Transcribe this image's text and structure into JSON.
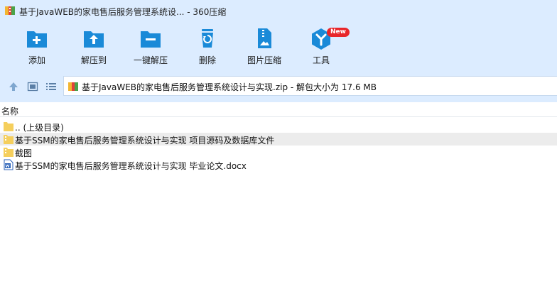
{
  "window": {
    "title": "基于JavaWEB的家电售后服务管理系统设...  - 360压缩"
  },
  "toolbar": {
    "add_label": "添加",
    "extract_label": "解压到",
    "one_click_label": "一键解压",
    "delete_label": "删除",
    "image_compress_label": "图片压缩",
    "tools_label": "工具",
    "tools_badge": "New"
  },
  "address": {
    "path": "基于JavaWEB的家电售后服务管理系统设计与实现.zip - 解包大小为 17.6 MB"
  },
  "list": {
    "column_name": "名称",
    "items": [
      {
        "name": ".. (上级目录)",
        "icon": "folder-up-icon"
      },
      {
        "name": "基于SSM的家电售后服务管理系统设计与实现 项目源码及数据库文件",
        "icon": "folder-zip-icon"
      },
      {
        "name": "截图",
        "icon": "folder-zip-icon"
      },
      {
        "name": "基于SSM的家电售后服务管理系统设计与实现 毕业论文.docx",
        "icon": "word-doc-icon"
      }
    ]
  },
  "colors": {
    "chrome": "#dcecff",
    "icon_blue": "#1a8ad8",
    "selected_row": "#ececec",
    "badge": "#e8262a"
  }
}
